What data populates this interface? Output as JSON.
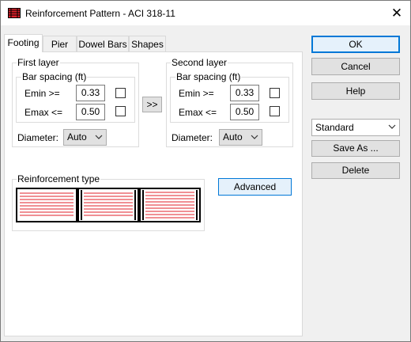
{
  "window": {
    "title": "Reinforcement Pattern - ACI 318-11",
    "close_label": "✕"
  },
  "tabs": [
    {
      "label": "Footing",
      "active": true
    },
    {
      "label": "Pier",
      "active": false
    },
    {
      "label": "Dowel Bars",
      "active": false
    },
    {
      "label": "Shapes",
      "active": false
    }
  ],
  "first_layer": {
    "legend": "First layer",
    "spacing_legend": "Bar spacing (ft)",
    "emin_label": "Emin >=",
    "emin_value": "0.33",
    "emin_checked": false,
    "emax_label": "Emax <=",
    "emax_value": "0.50",
    "emax_checked": false,
    "diameter_label": "Diameter:",
    "diameter_value": "Auto"
  },
  "copy_button_label": ">>",
  "second_layer": {
    "legend": "Second layer",
    "spacing_legend": "Bar spacing (ft)",
    "emin_label": "Emin >=",
    "emin_value": "0.33",
    "emin_checked": false,
    "emax_label": "Emax <=",
    "emax_value": "0.50",
    "emax_checked": false,
    "diameter_label": "Diameter:",
    "diameter_value": "Auto"
  },
  "reinforcement": {
    "legend": "Reinforcement type",
    "advanced_label": "Advanced",
    "patterns": [
      "pattern-1",
      "pattern-2",
      "pattern-3"
    ]
  },
  "actions": {
    "ok_label": "OK",
    "cancel_label": "Cancel",
    "help_label": "Help",
    "preset_value": "Standard",
    "save_as_label": "Save As ...",
    "delete_label": "Delete"
  },
  "colors": {
    "accent": "#0078d7",
    "bar_red": "#e0202a"
  }
}
